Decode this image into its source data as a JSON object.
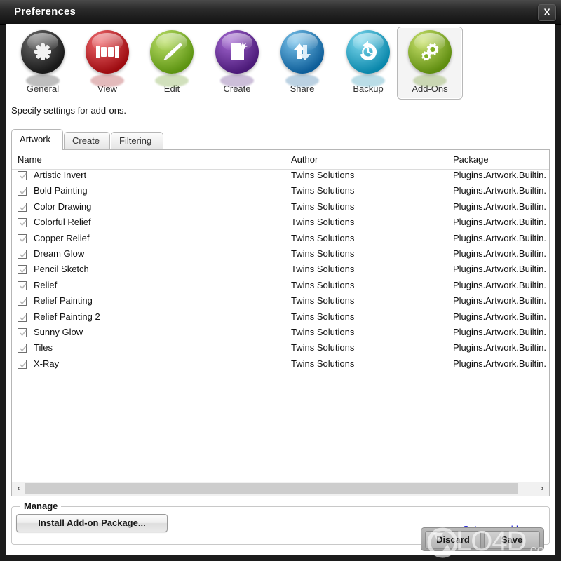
{
  "window": {
    "title": "Preferences",
    "close_label": "X"
  },
  "toolbar": {
    "items": [
      {
        "label": "General",
        "icon": "asterisk-orb-icon",
        "color": "#2b2b2b",
        "selected": false
      },
      {
        "label": "View",
        "icon": "filmstrip-orb-icon",
        "color": "#c81c22",
        "selected": false
      },
      {
        "label": "Edit",
        "icon": "brush-orb-icon",
        "color": "#7fbb2e",
        "selected": false
      },
      {
        "label": "Create",
        "icon": "newdoc-orb-icon",
        "color": "#6d2f9c",
        "selected": false
      },
      {
        "label": "Share",
        "icon": "sync-orb-icon",
        "color": "#1c7fc4",
        "selected": false
      },
      {
        "label": "Backup",
        "icon": "history-orb-icon",
        "color": "#12a8c8",
        "selected": false
      },
      {
        "label": "Add-Ons",
        "icon": "gears-orb-icon",
        "color": "#8fc02e",
        "selected": true
      }
    ]
  },
  "hint": "Specify settings for add-ons.",
  "tabs": [
    {
      "label": "Artwork",
      "active": true
    },
    {
      "label": "Create",
      "active": false
    },
    {
      "label": "Filtering",
      "active": false
    }
  ],
  "list": {
    "columns": [
      "Name",
      "Author",
      "Package"
    ],
    "rows": [
      {
        "checked": true,
        "name": "Artistic Invert",
        "author": "Twins Solutions",
        "package": "Plugins.Artwork.Builtin."
      },
      {
        "checked": true,
        "name": "Bold Painting",
        "author": "Twins Solutions",
        "package": "Plugins.Artwork.Builtin."
      },
      {
        "checked": true,
        "name": "Color Drawing",
        "author": "Twins Solutions",
        "package": "Plugins.Artwork.Builtin."
      },
      {
        "checked": true,
        "name": "Colorful Relief",
        "author": "Twins Solutions",
        "package": "Plugins.Artwork.Builtin."
      },
      {
        "checked": true,
        "name": "Copper Relief",
        "author": "Twins Solutions",
        "package": "Plugins.Artwork.Builtin."
      },
      {
        "checked": true,
        "name": "Dream Glow",
        "author": "Twins Solutions",
        "package": "Plugins.Artwork.Builtin."
      },
      {
        "checked": true,
        "name": "Pencil Sketch",
        "author": "Twins Solutions",
        "package": "Plugins.Artwork.Builtin."
      },
      {
        "checked": true,
        "name": "Relief",
        "author": "Twins Solutions",
        "package": "Plugins.Artwork.Builtin."
      },
      {
        "checked": true,
        "name": "Relief Painting",
        "author": "Twins Solutions",
        "package": "Plugins.Artwork.Builtin."
      },
      {
        "checked": true,
        "name": "Relief Painting 2",
        "author": "Twins Solutions",
        "package": "Plugins.Artwork.Builtin."
      },
      {
        "checked": true,
        "name": "Sunny Glow",
        "author": "Twins Solutions",
        "package": "Plugins.Artwork.Builtin."
      },
      {
        "checked": true,
        "name": "Tiles",
        "author": "Twins Solutions",
        "package": "Plugins.Artwork.Builtin."
      },
      {
        "checked": true,
        "name": "X-Ray",
        "author": "Twins Solutions",
        "package": "Plugins.Artwork.Builtin."
      }
    ],
    "scroll_left_arrow": "‹",
    "scroll_right_arrow": "›"
  },
  "manage": {
    "group_title": "Manage",
    "install_label": "Install Add-on Package...",
    "more_link": "Get more add-ons..."
  },
  "dialog_buttons": {
    "discard": "Discard",
    "save": "Save"
  },
  "watermark": {
    "main": "LO4D",
    "suffix": ".com"
  }
}
